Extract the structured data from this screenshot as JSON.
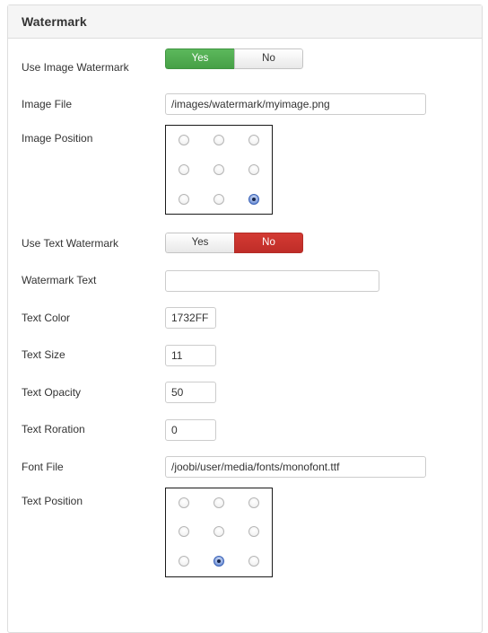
{
  "panel": {
    "title": "Watermark"
  },
  "fields": {
    "use_image_watermark": {
      "label": "Use Image Watermark",
      "yes_label": "Yes",
      "no_label": "No",
      "value": "Yes"
    },
    "image_file": {
      "label": "Image File",
      "value": "/images/watermark/myimage.png",
      "placeholder": ""
    },
    "image_position": {
      "label": "Image Position",
      "selected_index": 8,
      "options": [
        "top-left",
        "top-center",
        "top-right",
        "middle-left",
        "middle-center",
        "middle-right",
        "bottom-left",
        "bottom-center",
        "bottom-right"
      ]
    },
    "use_text_watermark": {
      "label": "Use Text Watermark",
      "yes_label": "Yes",
      "no_label": "No",
      "value": "No"
    },
    "watermark_text": {
      "label": "Watermark Text",
      "value": "",
      "placeholder": ""
    },
    "text_color": {
      "label": "Text Color",
      "value": "1732FF"
    },
    "text_size": {
      "label": "Text Size",
      "value": "11"
    },
    "text_opacity": {
      "label": "Text Opacity",
      "value": "50"
    },
    "text_rotation": {
      "label": "Text Roration",
      "value": "0"
    },
    "font_file": {
      "label": "Font File",
      "value": "/joobi/user/media/fonts/monofont.ttf"
    },
    "text_position": {
      "label": "Text Position",
      "selected_index": 7,
      "options": [
        "top-left",
        "top-center",
        "top-right",
        "middle-left",
        "middle-center",
        "middle-right",
        "bottom-left",
        "bottom-center",
        "bottom-right"
      ]
    }
  },
  "colors": {
    "active_yes": "#4aa34a",
    "active_no": "#bf2d28",
    "radio_selected": "#4a74c9",
    "panel_border": "#dddddd",
    "heading_bg": "#f5f5f5"
  }
}
